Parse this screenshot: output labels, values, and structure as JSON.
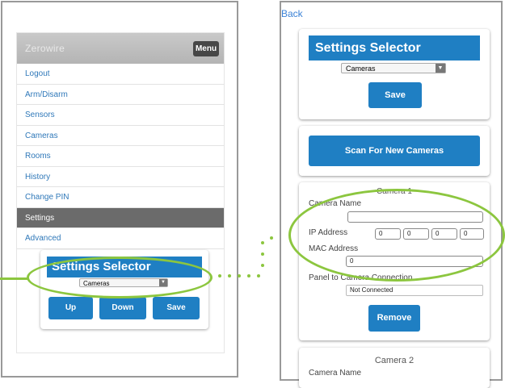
{
  "left": {
    "brand": "Zerowire",
    "menu_button": "Menu",
    "menu_items": [
      "Logout",
      "Arm/Disarm",
      "Sensors",
      "Cameras",
      "Rooms",
      "History",
      "Change PIN",
      "Settings",
      "Advanced"
    ],
    "active_item": "Settings",
    "settings_selector": {
      "title": "Settings Selector",
      "selected": "Cameras",
      "buttons": {
        "up": "Up",
        "down": "Down",
        "save": "Save"
      }
    }
  },
  "right": {
    "back": "Back",
    "settings_selector": {
      "title": "Settings Selector",
      "selected": "Cameras",
      "save": "Save"
    },
    "scan_button": "Scan For New Cameras",
    "camera1": {
      "heading": "Camera 1",
      "name_label": "Camera Name",
      "name_value": "",
      "ip_label": "IP Address",
      "ip_octets": [
        "0",
        "0",
        "0",
        "0"
      ],
      "mac_label": "MAC Address",
      "mac_value": "0",
      "connection_label": "Panel to Camera Connection",
      "connection_status": "Not Connected",
      "remove": "Remove"
    },
    "camera2": {
      "heading": "Camera 2",
      "name_label": "Camera Name"
    }
  },
  "colors": {
    "accent_blue": "#1f7fc3",
    "highlight_green": "#8cc63f",
    "active_menu": "#6b6b6b"
  }
}
